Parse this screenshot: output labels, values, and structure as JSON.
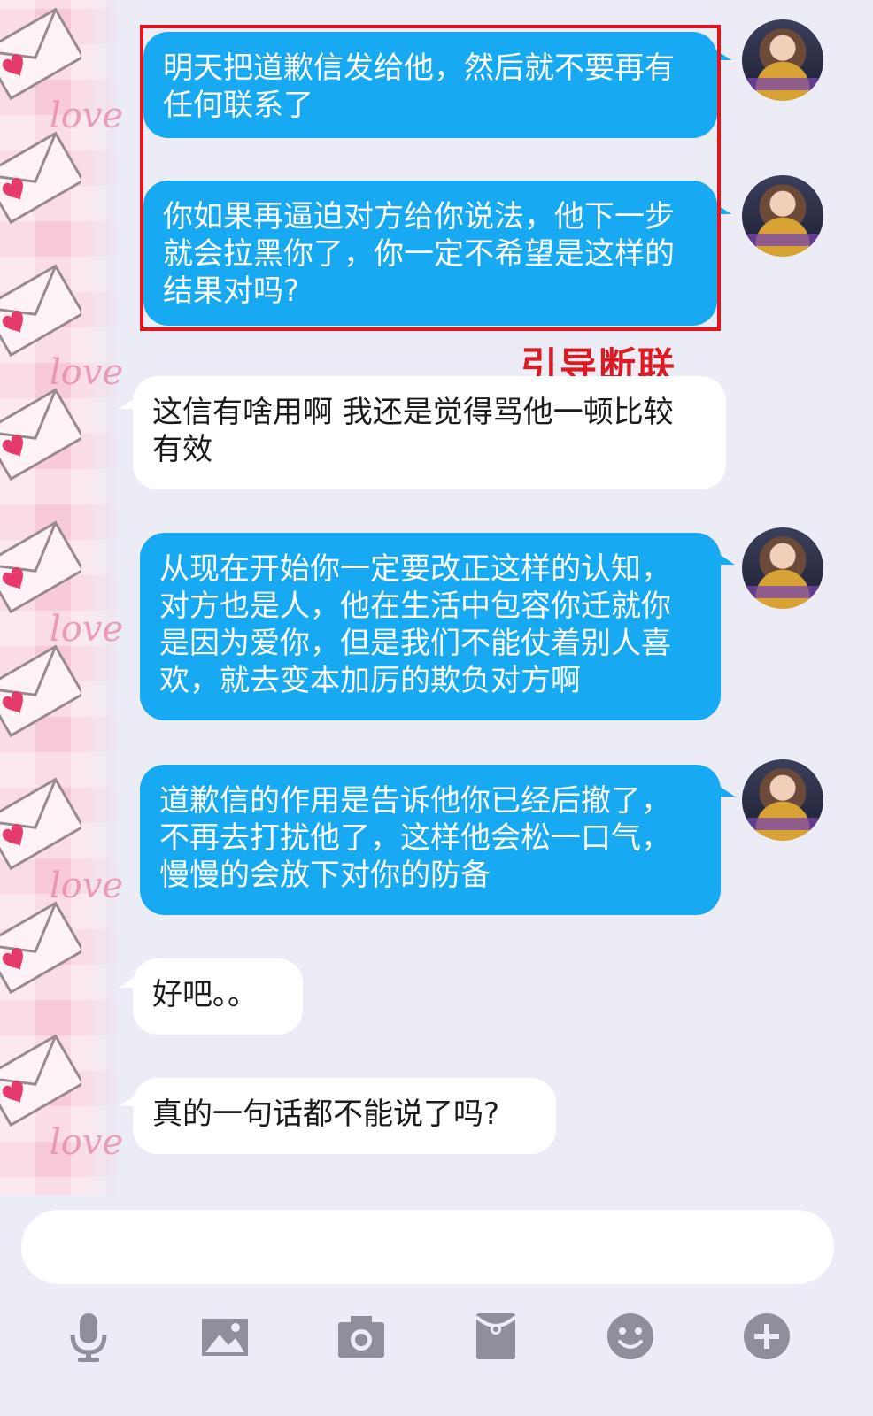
{
  "messages": [
    {
      "side": "out",
      "lines": [
        "明天把道歉信发给他，然后就不要再有",
        "任何联系了"
      ]
    },
    {
      "side": "out",
      "lines": [
        "你如果再逼迫对方给你说法，他下一步",
        "就会拉黑你了，你一定不希望是这样的",
        "结果对吗?"
      ]
    },
    {
      "side": "in",
      "lines": [
        "这信有啥用啊 我还是觉得骂他一顿比较",
        "有效"
      ]
    },
    {
      "side": "out",
      "lines": [
        "从现在开始你一定要改正这样的认知，",
        "对方也是人，他在生活中包容你迁就你",
        "是因为爱你，但是我们不能仗着别人喜",
        "欢，就去变本加厉的欺负对方啊"
      ]
    },
    {
      "side": "out",
      "lines": [
        "道歉信的作用是告诉他你已经后撤了，",
        "不再去打扰他了，这样他会松一口气，",
        "慢慢的会放下对你的防备"
      ]
    },
    {
      "side": "in",
      "lines": [
        "好吧。。"
      ]
    },
    {
      "side": "in",
      "lines": [
        "真的一句话都不能说了吗?"
      ]
    }
  ],
  "annotation": {
    "label": "引导断联",
    "color": "#dd1a22"
  },
  "wallpaper": {
    "love_text": "love"
  },
  "colors": {
    "outgoing_bubble": "#17a9f2",
    "incoming_bubble": "#ffffff",
    "background": "#ececf6"
  },
  "toolbar": [
    {
      "icon": "microphone-icon"
    },
    {
      "icon": "image-icon"
    },
    {
      "icon": "camera-icon"
    },
    {
      "icon": "red-packet-icon"
    },
    {
      "icon": "emoji-icon"
    },
    {
      "icon": "plus-icon"
    }
  ]
}
